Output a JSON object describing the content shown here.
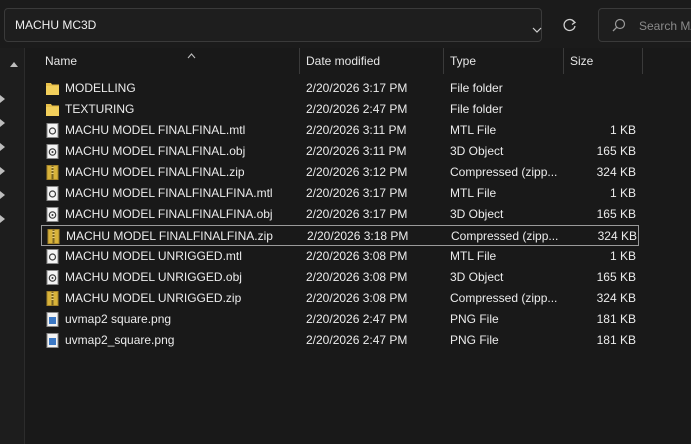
{
  "address": {
    "path": "MACHU MC3D"
  },
  "search": {
    "placeholder": "Search MA"
  },
  "columns": {
    "name": "Name",
    "date_modified": "Date modified",
    "type": "Type",
    "size": "Size"
  },
  "files": [
    {
      "icon": "folder-icon",
      "name": "MODELLING",
      "date": "2/20/2026 3:17 PM",
      "type": "File folder",
      "size": ""
    },
    {
      "icon": "folder-icon",
      "name": "TEXTURING",
      "date": "2/20/2026 2:47 PM",
      "type": "File folder",
      "size": ""
    },
    {
      "icon": "mtl-file-icon",
      "name": "MACHU MODEL FINALFINAL.mtl",
      "date": "2/20/2026 3:11 PM",
      "type": "MTL File",
      "size": "1 KB"
    },
    {
      "icon": "obj-file-icon",
      "name": "MACHU MODEL FINALFINAL.obj",
      "date": "2/20/2026 3:11 PM",
      "type": "3D Object",
      "size": "165 KB"
    },
    {
      "icon": "zip-file-icon",
      "name": "MACHU MODEL FINALFINAL.zip",
      "date": "2/20/2026 3:12 PM",
      "type": "Compressed (zipp...",
      "size": "324 KB"
    },
    {
      "icon": "mtl-file-icon",
      "name": "MACHU MODEL FINALFINALFINA.mtl",
      "date": "2/20/2026 3:17 PM",
      "type": "MTL File",
      "size": "1 KB"
    },
    {
      "icon": "obj-file-icon",
      "name": "MACHU MODEL FINALFINALFINA.obj",
      "date": "2/20/2026 3:17 PM",
      "type": "3D Object",
      "size": "165 KB"
    },
    {
      "icon": "zip-file-icon",
      "name": "MACHU MODEL FINALFINALFINA.zip",
      "date": "2/20/2026 3:18 PM",
      "type": "Compressed (zipp...",
      "size": "324 KB"
    },
    {
      "icon": "mtl-file-icon",
      "name": "MACHU MODEL UNRIGGED.mtl",
      "date": "2/20/2026 3:08 PM",
      "type": "MTL File",
      "size": "1 KB"
    },
    {
      "icon": "obj-file-icon",
      "name": "MACHU MODEL UNRIGGED.obj",
      "date": "2/20/2026 3:08 PM",
      "type": "3D Object",
      "size": "165 KB"
    },
    {
      "icon": "zip-file-icon",
      "name": "MACHU MODEL UNRIGGED.zip",
      "date": "2/20/2026 3:08 PM",
      "type": "Compressed (zipp...",
      "size": "324 KB"
    },
    {
      "icon": "png-file-icon",
      "name": "uvmap2 square.png",
      "date": "2/20/2026 2:47 PM",
      "type": "PNG File",
      "size": "181 KB"
    },
    {
      "icon": "png-file-icon",
      "name": "uvmap2_square.png",
      "date": "2/20/2026 2:47 PM",
      "type": "PNG File",
      "size": "181 KB"
    }
  ],
  "colors": {
    "background": "#191919",
    "folder": "#e8c04a",
    "zip": "#d8b33a",
    "selection_border": "#9a9a9a"
  }
}
